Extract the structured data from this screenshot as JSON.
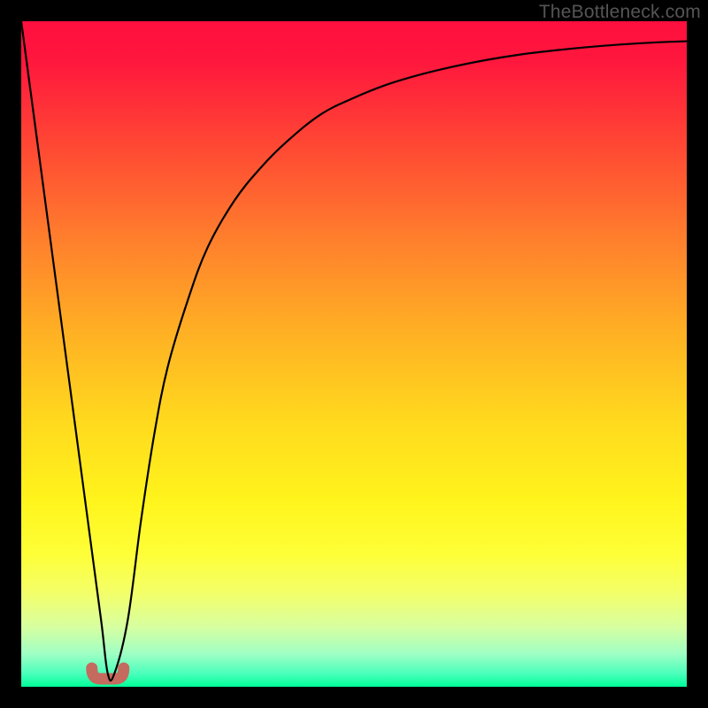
{
  "watermark": "TheBottleneck.com",
  "colors": {
    "background": "#000000",
    "gradient_top": "#ff0f3e",
    "gradient_bottom": "#00ff99",
    "curve": "#000000",
    "marker": "#c56a5e"
  },
  "chart_data": {
    "type": "line",
    "title": "",
    "xlabel": "",
    "ylabel": "",
    "xlim": [
      0,
      100
    ],
    "ylim": [
      0,
      100
    ],
    "x": [
      0,
      2,
      4,
      6,
      8,
      10,
      12,
      13,
      14,
      16,
      18,
      20,
      22,
      25,
      28,
      32,
      36,
      40,
      45,
      50,
      55,
      60,
      65,
      70,
      75,
      80,
      85,
      90,
      95,
      100
    ],
    "values": [
      100,
      85,
      70,
      55,
      40,
      25,
      10,
      2,
      2,
      10,
      25,
      38,
      48,
      58,
      66,
      73,
      78,
      82,
      86,
      88.5,
      90.5,
      92,
      93.2,
      94.2,
      95,
      95.6,
      96.1,
      96.5,
      96.8,
      97
    ],
    "minimum_x": 13,
    "minimum_y": 2
  }
}
